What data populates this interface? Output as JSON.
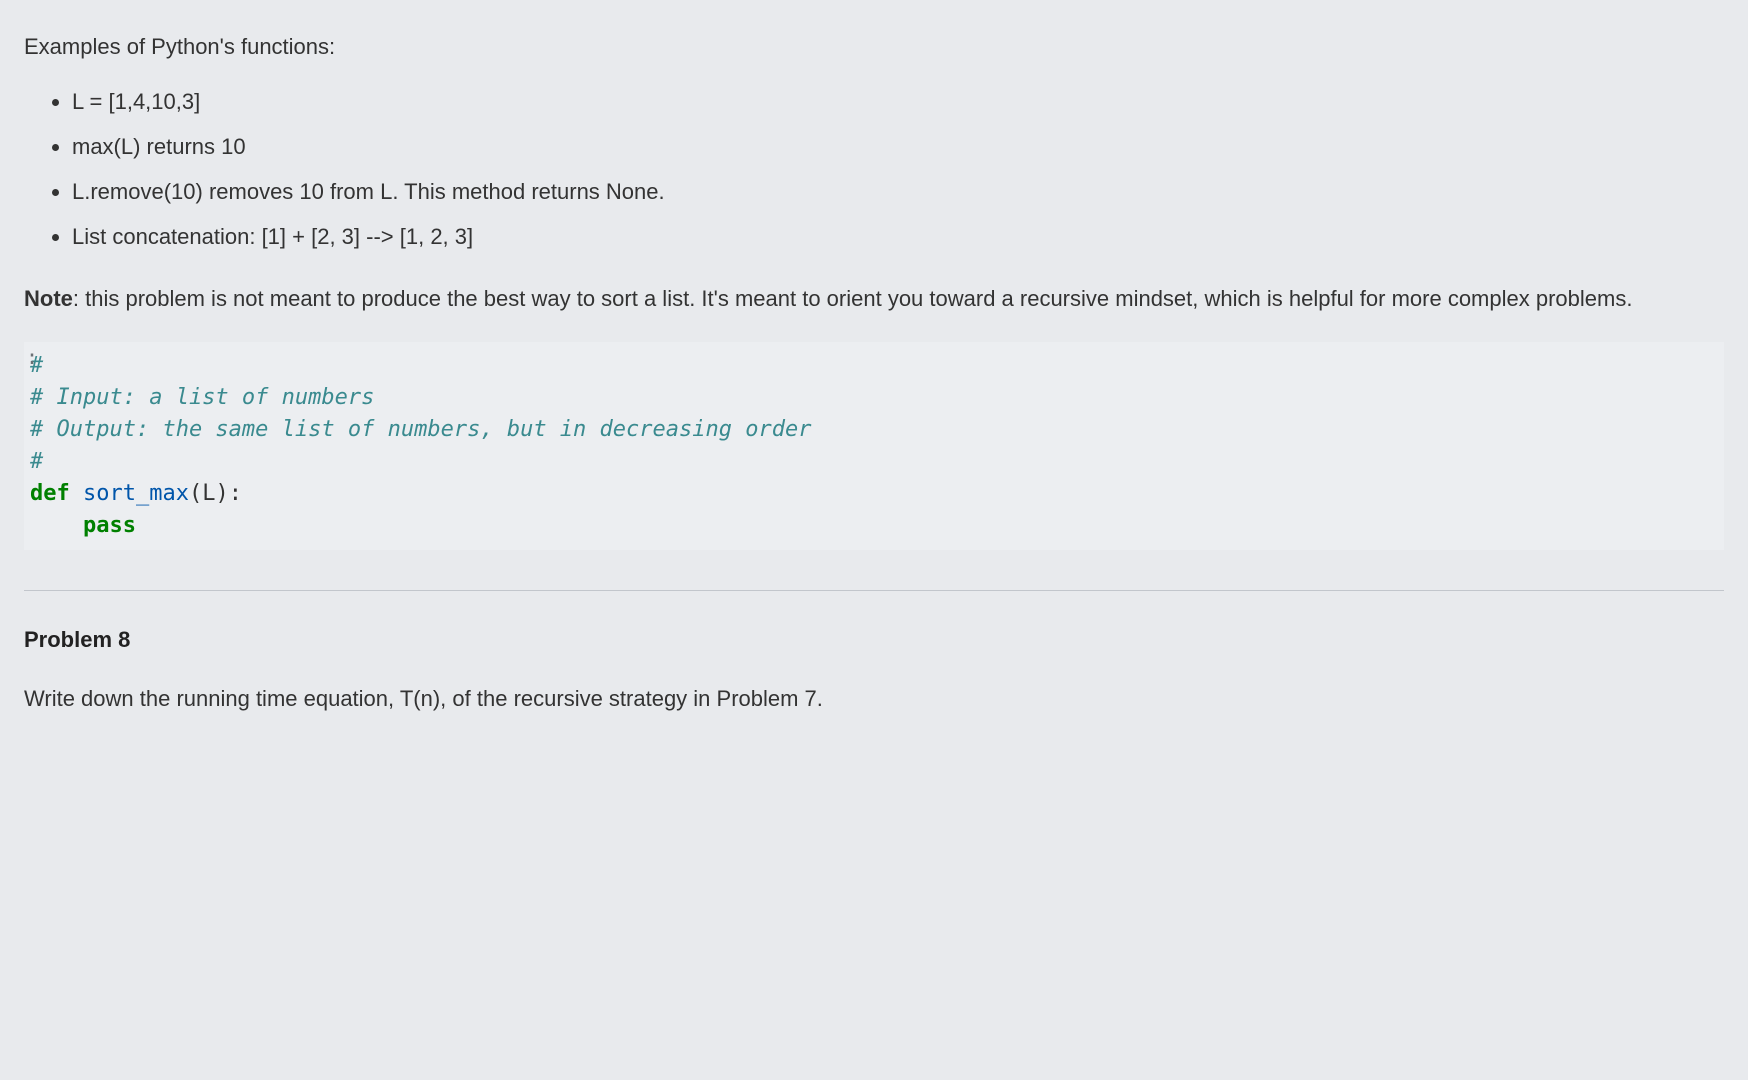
{
  "intro": "Examples of Python's functions:",
  "bullets": [
    "L = [1,4,10,3]",
    "max(L) returns 10",
    "L.remove(10) removes 10 from L. This method returns None.",
    "List concatenation: [1] + [2, 3] --> [1, 2, 3]"
  ],
  "note_label": "Note",
  "note_body": ": this problem is not meant to produce the best way to sort a list. It's meant to orient you toward a recursive mindset, which is helpful for more complex problems.",
  "code": {
    "c1": "#",
    "c2": "# Input: a list of numbers",
    "c3": "# Output: the same list of numbers, but in decreasing order",
    "c4": "#",
    "kw_def": "def",
    "fn_name": " sort_max",
    "paren_open": "(",
    "param": "L",
    "paren_close": "):",
    "kw_pass": "pass"
  },
  "prompt_marker": ":",
  "problem_heading": "Problem 8",
  "problem_text": "Write down the running time equation, T(n), of the recursive strategy in Problem 7."
}
